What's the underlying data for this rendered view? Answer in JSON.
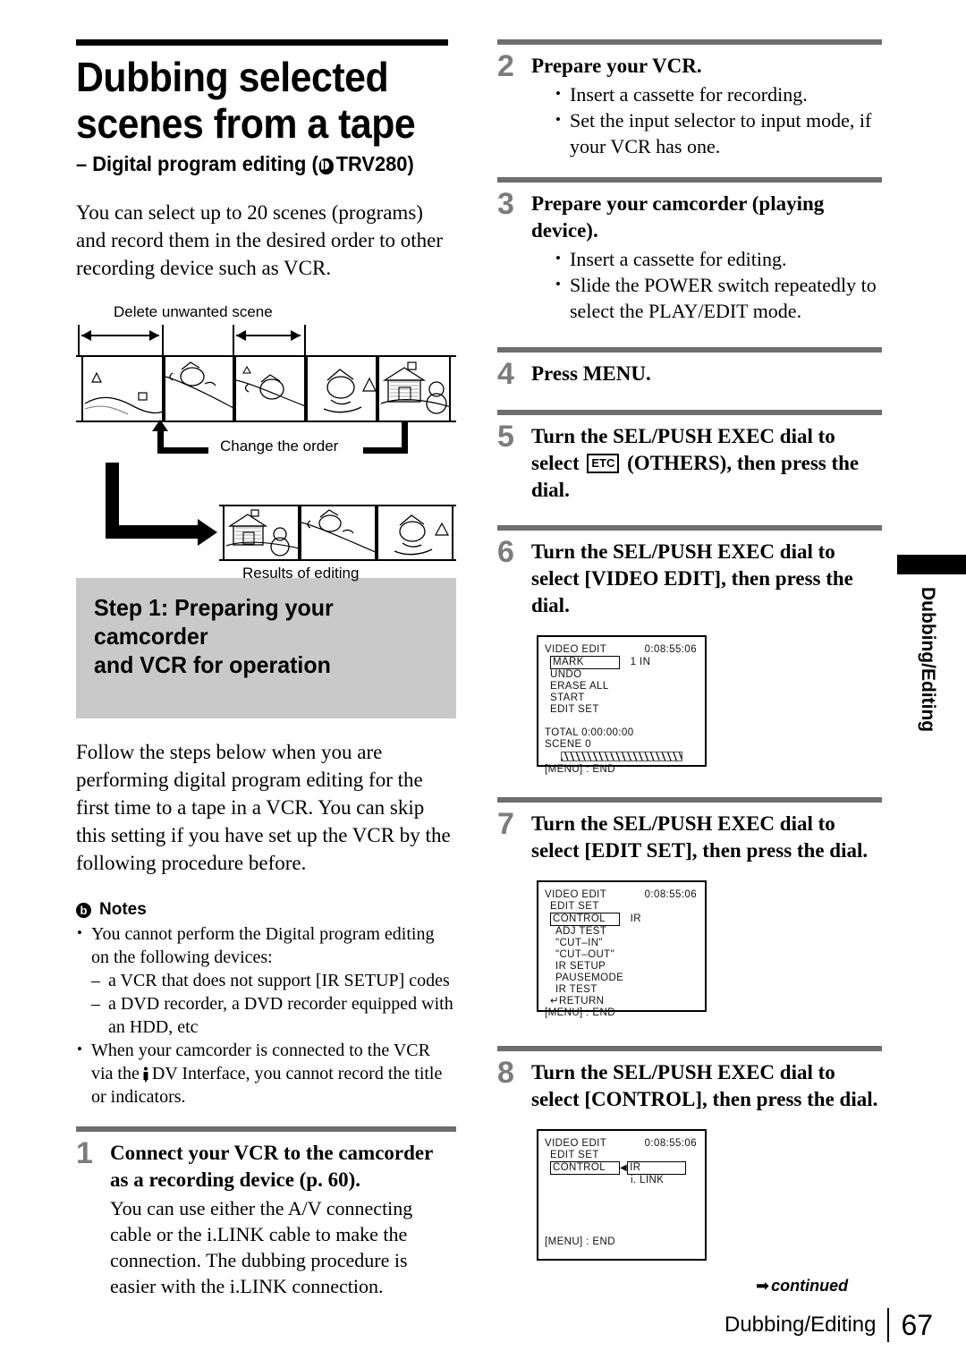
{
  "document": {
    "title_line1": "Dubbing selected",
    "title_line2": "scenes from a tape",
    "subtitle_prefix": "– Digital program editing (",
    "subtitle_model": "TRV280",
    "subtitle_suffix": ")",
    "model_badge_icon": "dcr-logo-icon",
    "intro": "You can select up to 20 scenes (programs) and record them in the desired order to other recording device such as VCR."
  },
  "diagram": {
    "label_delete": "Delete unwanted scene",
    "label_change_order": "Change the order",
    "label_results": "Results of editing",
    "top_frames": [
      "scene-hill",
      "scene-sledding",
      "scene-skiing",
      "scene-walking",
      "scene-cabin-snowman"
    ],
    "bottom_frames": [
      "scene-cabin-snowman",
      "scene-sledding",
      "scene-walking"
    ]
  },
  "step1_box": {
    "heading_line1": "Step 1: Preparing your camcorder",
    "heading_line2": "and VCR for operation"
  },
  "step1_para": "Follow the steps below when you are performing digital program editing for the first time to a tape in a VCR. You can skip this setting if you have set up the VCR by the following procedure before.",
  "notes": {
    "icon": "note-exclamation-icon",
    "heading": "Notes",
    "items": [
      "You cannot perform the Digital program editing on the following devices:",
      "When your camcorder is connected to the VCR via the"
    ],
    "item2_tail": "DV Interface, you cannot record the title or indicators.",
    "subitems": [
      "a VCR that does not support [IR SETUP] codes",
      "a DVD recorder, a DVD recorder equipped with an HDD, etc"
    ]
  },
  "steps": [
    {
      "num": "1",
      "title": "Connect your VCR to the camcorder as a recording device (p. 60).",
      "sub": "You can use either the A/V connecting cable or the i.LINK cable to make the connection. The dubbing procedure is easier with the i.LINK connection."
    },
    {
      "num": "2",
      "title": "Prepare your VCR.",
      "bullets": [
        "Insert a cassette for recording.",
        "Set the input selector to input mode, if your VCR has one."
      ]
    },
    {
      "num": "3",
      "title": "Prepare your camcorder (playing device).",
      "bullets": [
        "Insert a cassette for editing.",
        "Slide the POWER switch repeatedly to select the PLAY/EDIT mode."
      ]
    },
    {
      "num": "4",
      "title": "Press MENU."
    },
    {
      "num": "5",
      "title_pre": "Turn the SEL/PUSH EXEC dial to select",
      "icon_label": "ETC",
      "title_post": "(OTHERS), then press the dial."
    },
    {
      "num": "6",
      "title": "Turn the SEL/PUSH EXEC dial to select [VIDEO EDIT], then press the dial."
    },
    {
      "num": "7",
      "title": "Turn the SEL/PUSH EXEC dial to select [EDIT SET], then press the dial."
    },
    {
      "num": "8",
      "title": "Turn the SEL/PUSH EXEC dial to select [CONTROL], then press the dial."
    }
  ],
  "lcd1": {
    "header": "VIDEO EDIT",
    "timecode": "0:08:55:06",
    "selected": "MARK",
    "selected_value": "1   IN",
    "menu": [
      "UNDO",
      "ERASE ALL",
      "START",
      "EDIT SET"
    ],
    "total_label": "TOTAL  0:00:00:00",
    "scene_label": "SCENE 0",
    "footer": "[MENU] : END"
  },
  "lcd2": {
    "header": "VIDEO EDIT",
    "timecode": "0:08:55:06",
    "subheader": "EDIT SET",
    "selected": "CONTROL",
    "selected_value": "IR",
    "menu": [
      "ADJ TEST",
      "\"CUT–IN\"",
      "\"CUT–OUT\"",
      "IR SETUP",
      "PAUSEMODE",
      "IR TEST"
    ],
    "return_label": "RETURN",
    "footer": "[MENU] : END"
  },
  "lcd3": {
    "header": "VIDEO EDIT",
    "timecode": "0:08:55:06",
    "subheader": "EDIT SET",
    "selected": "CONTROL",
    "option1": "IR",
    "option2": "i. LINK",
    "footer": "[MENU] : END"
  },
  "side_tab": {
    "label": "Dubbing/Editing"
  },
  "footer": {
    "continued": "continued",
    "continued_arrow": "➡",
    "chapter": "Dubbing/Editing",
    "page": "67"
  }
}
